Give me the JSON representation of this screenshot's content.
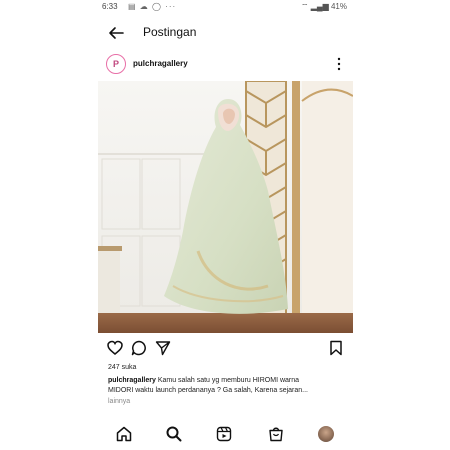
{
  "status_bar": {
    "time": "6:33",
    "left_icons": "▤ ☁ ◯ ···",
    "right_text": "41%"
  },
  "header": {
    "title": "Postingan"
  },
  "post": {
    "username": "pulchragallery",
    "avatar_text": "P",
    "likes": "247 suka",
    "caption_user": "pulchragallery",
    "caption_line1": "Kamu salah satu yg memburu HIROMI warna",
    "caption_line2": "MIDORI waktu launch perdananya ? Ga salah, Karena sejaran...",
    "more_label": "lainnya"
  },
  "icons": {
    "back": "back-arrow-icon",
    "more": "more-vertical-icon",
    "like": "heart-icon",
    "comment": "comment-icon",
    "share": "send-icon",
    "save": "bookmark-icon",
    "home": "home-icon",
    "search": "search-icon",
    "reels": "reels-icon",
    "shop": "shop-icon",
    "profile": "profile-avatar-icon"
  },
  "colors": {
    "brand_avatar": "#c0487f",
    "text": "#111111",
    "muted": "#888888"
  }
}
